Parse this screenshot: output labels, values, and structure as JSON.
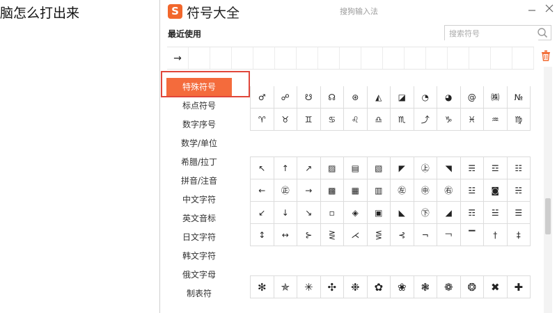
{
  "document": {
    "text": "脑怎么打出来"
  },
  "panel": {
    "title": "符号大全",
    "logo": "S",
    "ime_label": "搜狗输入法",
    "recent_label": "最近使用",
    "search_placeholder": "搜索符号",
    "recent_symbols": [
      "→",
      "",
      "",
      "",
      "",
      "",
      "",
      "",
      "",
      "",
      "",
      "",
      "",
      "",
      "",
      "",
      ""
    ],
    "categories": [
      "特殊符号",
      "标点符号",
      "数字序号",
      "数学/单位",
      "希腊/拉丁",
      "拼音/注音",
      "中文字符",
      "英文音标",
      "日文字符",
      "韩文字符",
      "俄文字母",
      "制表符"
    ],
    "grid1": [
      "♂",
      "☍",
      "☋",
      "☊",
      "⊛",
      "◭",
      "◪",
      "◔",
      "◕",
      "@",
      "㈱",
      "№",
      "♈",
      "♉",
      "♊",
      "♋",
      "♌",
      "♎",
      "♏",
      "⤴",
      "♑",
      "♓",
      "♒",
      "♍"
    ],
    "grid2": [
      "↖",
      "↑",
      "↗",
      "▨",
      "▤",
      "▧",
      "◤",
      "㊤",
      "◥",
      "☴",
      "☲",
      "☷",
      "←",
      "㊣",
      "→",
      "▩",
      "▦",
      "▥",
      "㊧",
      "㊥",
      "㊨",
      "☳",
      "◙",
      "☵",
      "↙",
      "↓",
      "↘",
      "▫",
      "◈",
      "▣",
      "◣",
      "㊦",
      "◢",
      "☶",
      "☱",
      "☰",
      "↕",
      "↔",
      "⊱",
      "⋛",
      "⋌",
      "⋚",
      "⊰",
      "¬",
      "￢",
      "▔",
      "†",
      "‡"
    ],
    "grid3": [
      "✻",
      "✯",
      "✳",
      "✣",
      "❉",
      "✿",
      "❀",
      "❃",
      "❁",
      "❂",
      "✖",
      "✚"
    ]
  },
  "colors": {
    "accent": "#f46b3c",
    "highlight_border": "#e0463a"
  }
}
